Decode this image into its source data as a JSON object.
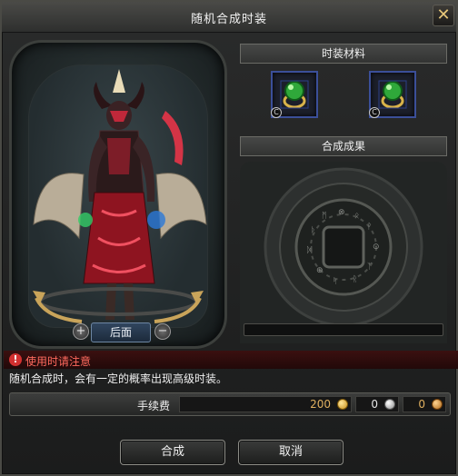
{
  "window": {
    "title": "随机合成时装",
    "close_label": "✕"
  },
  "preview": {
    "view_button_label": "后面",
    "rotate_left_label": "+",
    "rotate_right_label": "−"
  },
  "materials": {
    "header": "时装材料",
    "slots": [
      {
        "icon": "green-gem-ring-icon",
        "badge": "C"
      },
      {
        "icon": "green-gem-ring-icon",
        "badge": "C"
      }
    ]
  },
  "result": {
    "header": "合成成果",
    "progress": 0
  },
  "notice": {
    "title": "使用时请注意",
    "text": "随机合成时，会有一定的概率出现高级时装。"
  },
  "fee": {
    "label": "手续费",
    "gold": "200",
    "silver": "0",
    "bronze": "0"
  },
  "actions": {
    "confirm_label": "合成",
    "cancel_label": "取消"
  },
  "colors": {
    "accent_gold": "#e0b060",
    "notice_red": "#ff6a5e",
    "slot_border": "#3b4f99"
  }
}
